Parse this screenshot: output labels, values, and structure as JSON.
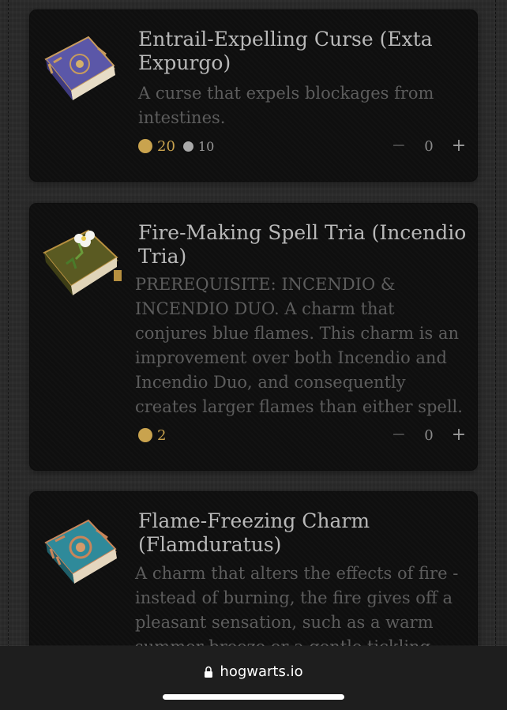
{
  "spells": [
    {
      "title": "Entrail-Expelling Curse (Exta Expurgo)",
      "description": "A curse that expels blockages from intestines.",
      "gold_cost": "20",
      "silver_cost": "10",
      "quantity": "0",
      "book_colors": {
        "cover": "#5b57a8",
        "trim": "#c79b5e",
        "pages": "#e7dcc6"
      }
    },
    {
      "title": "Fire-Making Spell Tria (Incendio Tria)",
      "description": "PREREQUISITE: INCENDIO & INCENDIO DUO. A charm that conjures blue flames. This charm is an improvement over both Incendio and Incendio Duo, and consequently creates larger flames than either spell.",
      "gold_cost": "2",
      "quantity": "0",
      "book_colors": {
        "cover": "#5a5a22",
        "trim": "#b79040",
        "pages": "#e0d4b8"
      }
    },
    {
      "title": "Flame-Freezing Charm (Flamduratus)",
      "description": "A charm that alters the effects of fire - instead of burning, the fire gives off a pleasant sensation, such as a warm summer breeze or a gentle tickling",
      "book_colors": {
        "cover": "#2f8a9a",
        "trim": "#c9855a",
        "pages": "#e4d6be"
      }
    }
  ],
  "controls": {
    "minus_symbol": "−",
    "plus_symbol": "+"
  },
  "browser": {
    "url": "hogwarts.io",
    "lock_icon": "lock-icon"
  },
  "colors": {
    "gold": "#c9a34e",
    "silver": "#a9a9a9",
    "card_bg": "#0f0f0f",
    "page_bg": "#2a2a2a"
  }
}
